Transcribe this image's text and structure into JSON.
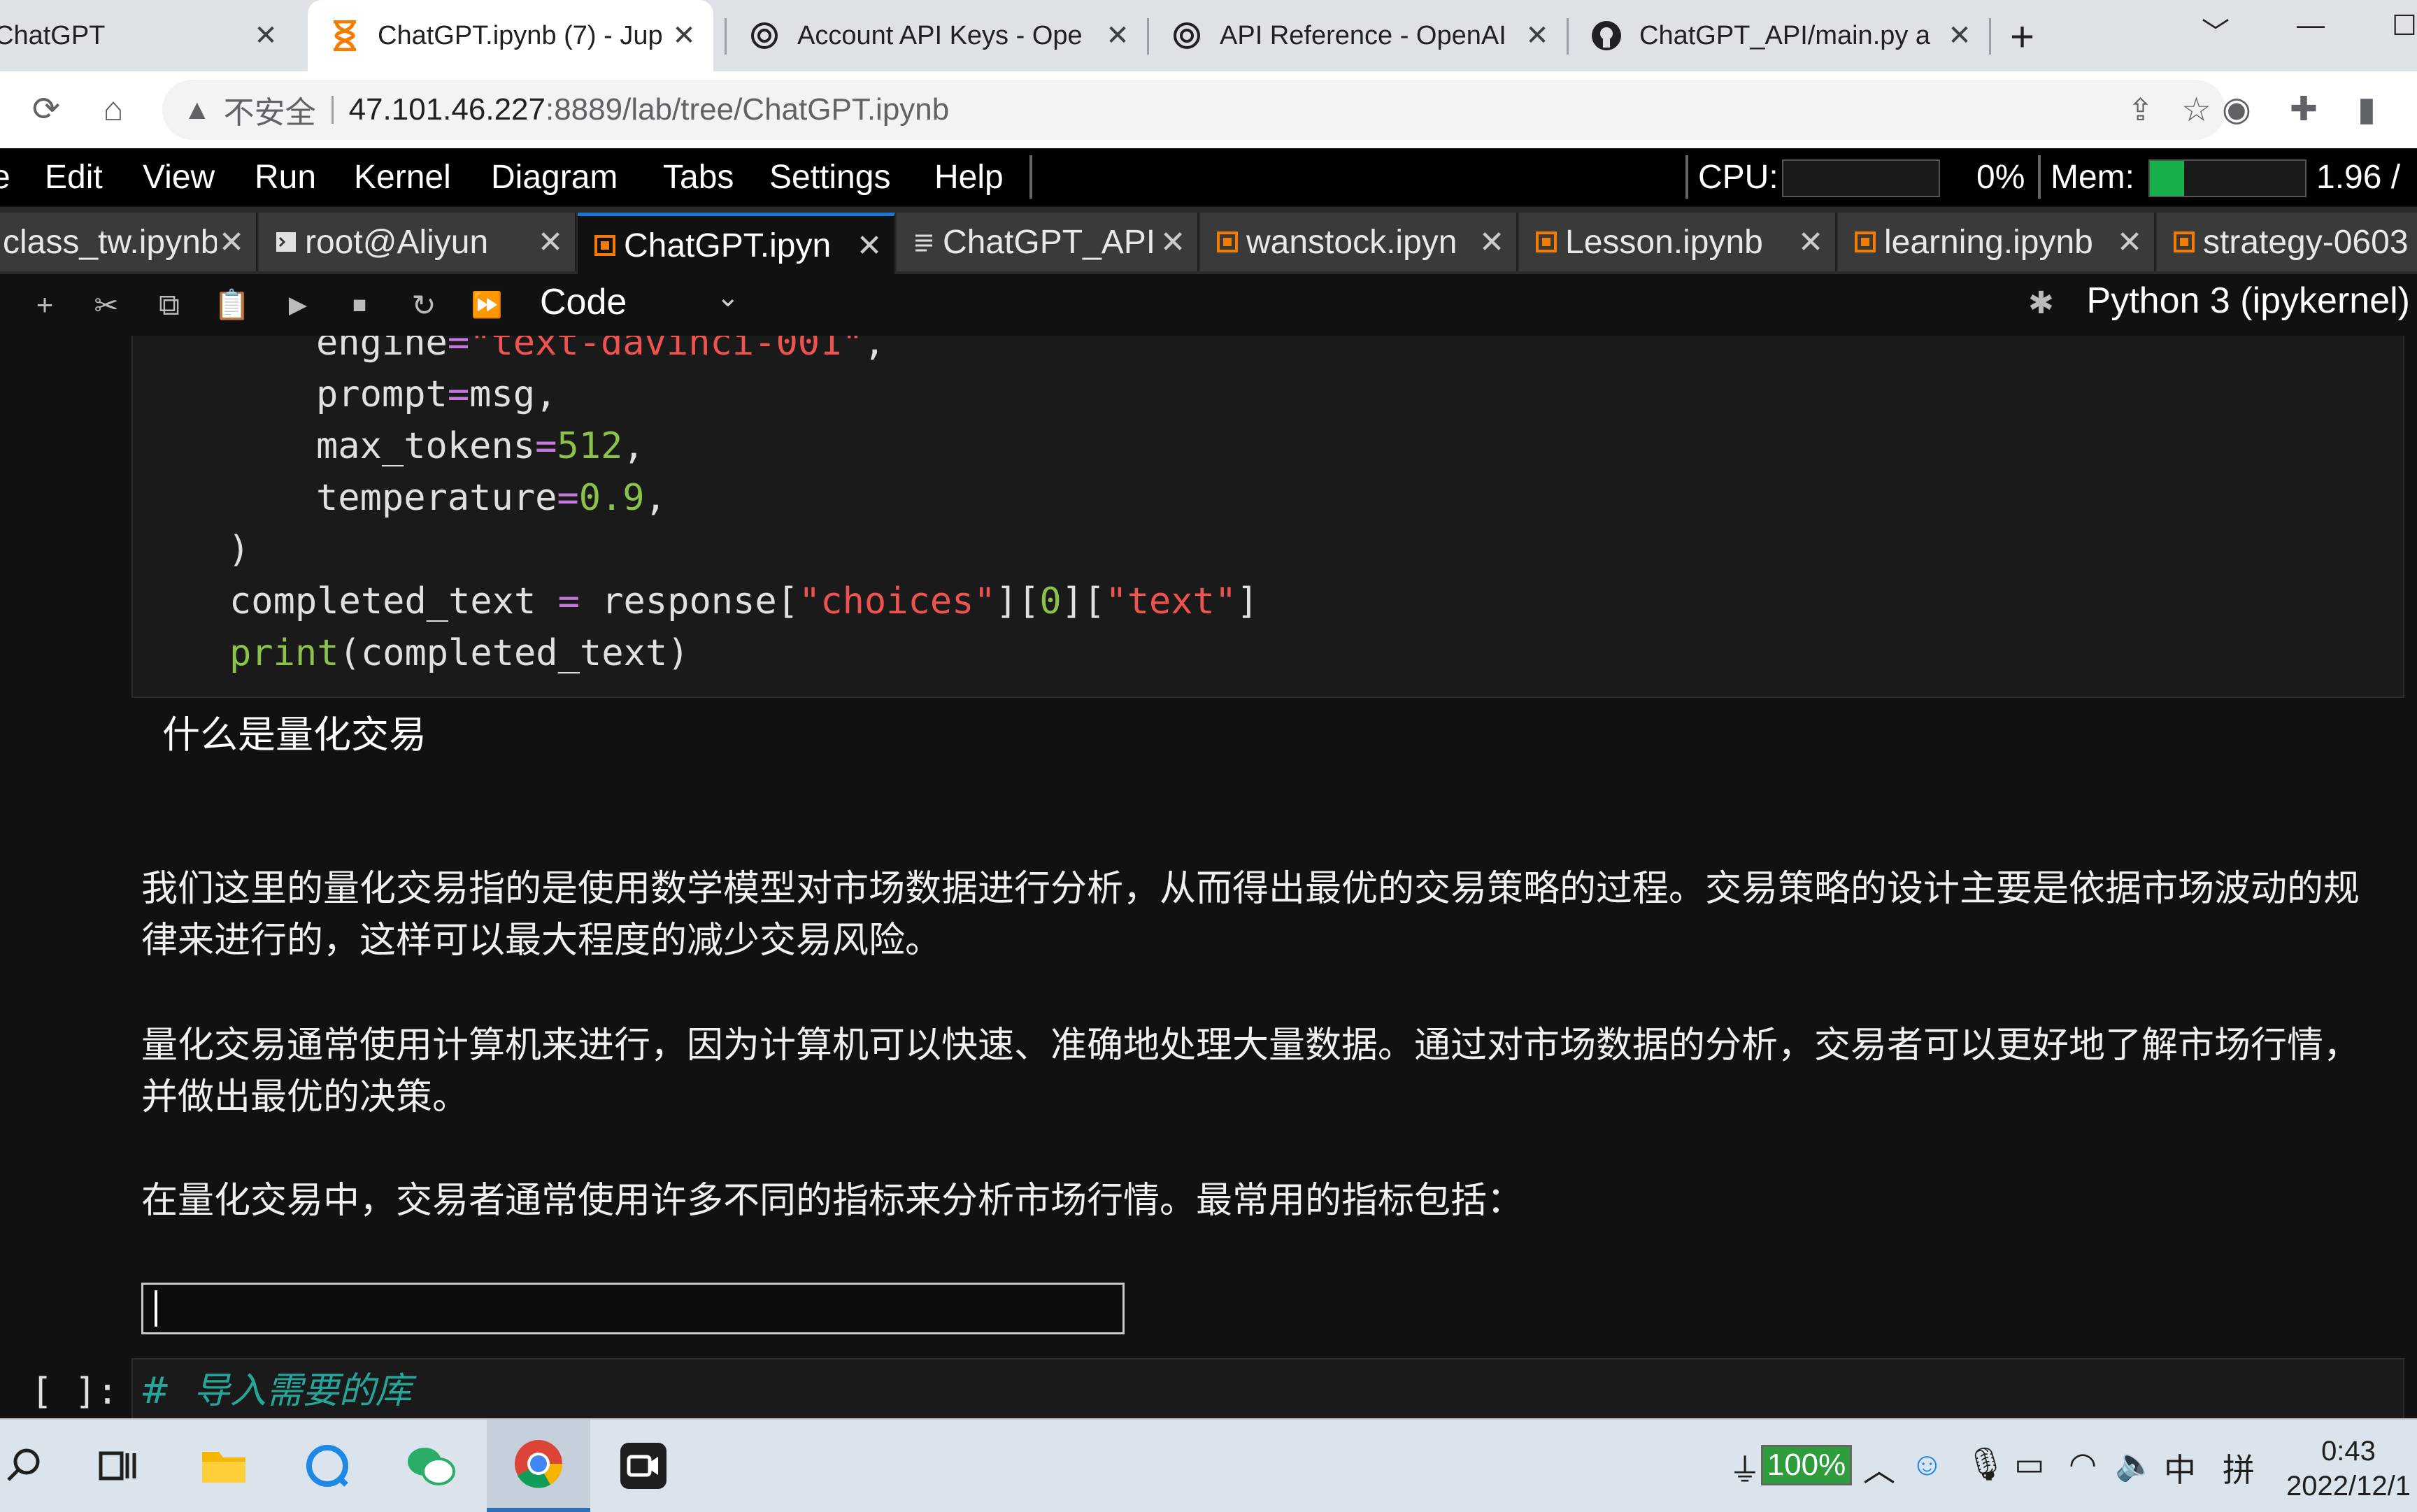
{
  "browser": {
    "tabs": [
      {
        "title": "ChatGPT",
        "icon": "openai-icon",
        "active": false
      },
      {
        "title": "ChatGPT.ipynb (7) - Jup",
        "icon": "hourglass-icon",
        "active": true
      },
      {
        "title": "Account API Keys - Ope",
        "icon": "openai-icon",
        "active": false
      },
      {
        "title": "API Reference - OpenAI",
        "icon": "openai-icon",
        "active": false
      },
      {
        "title": "ChatGPT_API/main.py a",
        "icon": "github-icon",
        "active": false
      }
    ],
    "close_glyph": "✕",
    "new_tab_glyph": "+",
    "address": {
      "insecure_label": "不安全",
      "host": "47.101.46.227",
      "path": ":8889/lab/tree/ChatGPT.ipynb"
    }
  },
  "jupyter": {
    "menu": [
      "Edit",
      "View",
      "Run",
      "Kernel",
      "Diagram",
      "Tabs",
      "Settings",
      "Help"
    ],
    "cpu_label": "CPU:",
    "cpu_value": "0%",
    "mem_label": "Mem:",
    "mem_value": "1.96 /",
    "mem_fraction": 0.22,
    "colors": {
      "mem_bar": "#18b04a",
      "active_tab_border": "#1976d2"
    },
    "tabs": [
      {
        "title": "class_tw.ipynb",
        "icon": "notebook-icon",
        "active": false
      },
      {
        "title": "root@Aliyun",
        "icon": "terminal-icon",
        "active": false
      },
      {
        "title": "ChatGPT.ipyn",
        "icon": "notebook-icon",
        "active": true
      },
      {
        "title": "ChatGPT_API.",
        "icon": "file-icon",
        "active": false
      },
      {
        "title": "wanstock.ipyn",
        "icon": "notebook-icon",
        "active": false
      },
      {
        "title": "Lesson.ipynb",
        "icon": "notebook-icon",
        "active": false
      },
      {
        "title": "learning.ipynb",
        "icon": "notebook-icon",
        "active": false
      },
      {
        "title": "strategy-0603",
        "icon": "notebook-icon",
        "active": false
      }
    ],
    "toolbar": {
      "cell_type": "Code",
      "kernel": "Python 3 (ipykernel)"
    }
  },
  "cell": {
    "output_title": "什么是量化交易",
    "output_paragraphs": [
      "我们这里的量化交易指的是使用数学模型对市场数据进行分析，从而得出最优的交易策略的过程。交易策略的设计主要是依据市场波动的规律来进行的，这样可以最大程度的减少交易风险。",
      "量化交易通常使用计算机来进行，因为计算机可以快速、准确地处理大量数据。通过对市场数据的分析，交易者可以更好地了解市场行情，并做出最优的决策。",
      "在量化交易中，交易者通常使用许多不同的指标来分析市场行情。最常用的指标包括："
    ],
    "next_prompt": "[ ]:",
    "next_comment": "#  导入需要的库"
  },
  "taskbar": {
    "battery": "100%",
    "ime": "中",
    "ime2": "拼",
    "time": "0:43",
    "date": "2022/12/1"
  }
}
